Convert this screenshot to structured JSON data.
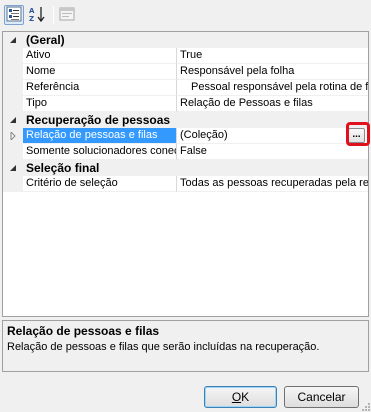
{
  "toolbar": {
    "categorized_icon": "categorized-view-icon",
    "alphabetical_icon": "sort-az-icon",
    "pages_icon": "property-pages-icon"
  },
  "grid": {
    "categories": [
      {
        "label": "(Geral)",
        "properties": [
          {
            "name": "Ativo",
            "value": "True"
          },
          {
            "name": "Nome",
            "value": "Responsável pela folha"
          },
          {
            "name": "Referência",
            "value": "Pessoal responsável pela rotina de fo"
          },
          {
            "name": "Tipo",
            "value": "Relação de Pessoas e filas"
          }
        ]
      },
      {
        "label": "Recuperação de pessoas",
        "properties": [
          {
            "name": "Relação de pessoas e filas",
            "value": "(Coleção)",
            "selected": true,
            "button_label": "..."
          },
          {
            "name": "Somente solucionadores conec",
            "value": "False"
          }
        ]
      },
      {
        "label": "Seleção final",
        "properties": [
          {
            "name": "Critério de seleção",
            "value": "Todas as pessoas recuperadas pela reg"
          }
        ]
      }
    ]
  },
  "help": {
    "title": "Relação de pessoas e filas",
    "description": "Relação de pessoas e filas que serão incluídas na recuperação."
  },
  "buttons": {
    "ok_accel": "O",
    "ok_rest": "K",
    "cancel_label": "Cancelar"
  },
  "colors": {
    "selection": "#3399ff",
    "highlight_ring": "#e0111d"
  }
}
